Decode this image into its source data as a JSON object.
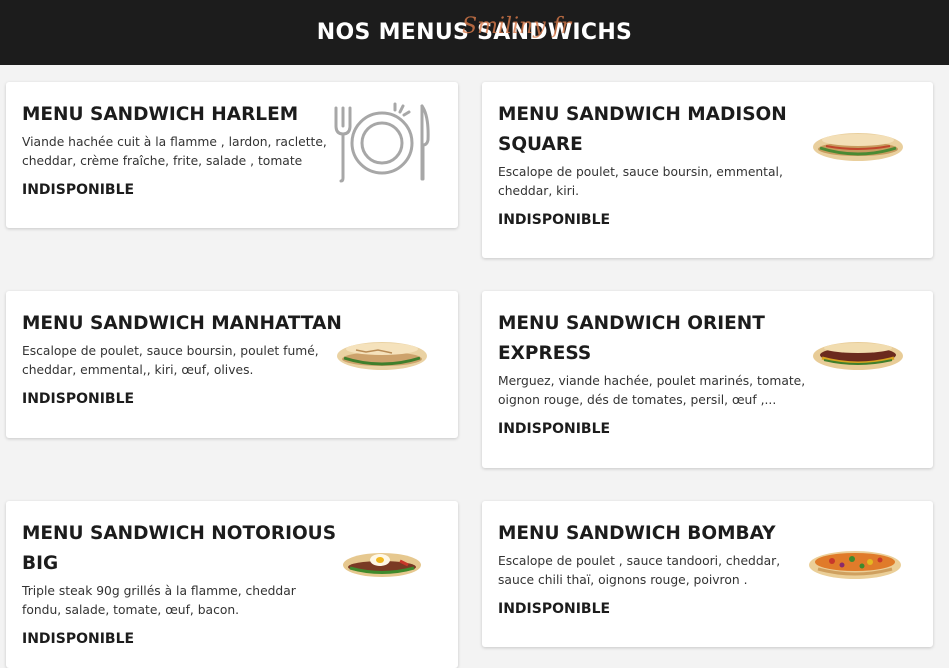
{
  "header": {
    "title": "NOS MENUS SANDWICHS",
    "watermark": "Smiliny fr"
  },
  "colors": {
    "header_bg": "#1c1c1c",
    "card_bg": "#ffffff",
    "page_bg": "#f3f3f3",
    "watermark": "#d97a4a"
  },
  "menus": [
    {
      "title": "MENU SANDWICH HARLEM",
      "desc_lines": [
        "Viande hachée cuit à la flamme , lardon, raclette,",
        "cheddar, crème fraîche, frite, salade , tomate"
      ],
      "status": "INDISPONIBLE",
      "icon": "plate-cutlery-icon"
    },
    {
      "title_lines": [
        "MENU SANDWICH MADISON",
        "SQUARE"
      ],
      "desc_lines": [
        "Escalope de poulet, sauce boursin, emmental,",
        "cheddar, kiri."
      ],
      "status": "INDISPONIBLE",
      "icon": "sandwich-icon"
    },
    {
      "title": "MENU SANDWICH MANHATTAN",
      "desc_lines": [
        "Escalope de poulet, sauce boursin, poulet fumé,",
        "cheddar, emmental,, kiri, œuf, olives."
      ],
      "status": "INDISPONIBLE",
      "icon": "sandwich-icon"
    },
    {
      "title_lines": [
        "MENU SANDWICH ORIENT",
        "EXPRESS"
      ],
      "desc_lines": [
        "Merguez, viande hachée, poulet marinés, tomate,",
        "oignon rouge, dés de tomates, persil, œuf ,..."
      ],
      "status": "INDISPONIBLE",
      "icon": "sandwich-icon"
    },
    {
      "title_lines": [
        "MENU SANDWICH NOTORIOUS",
        "BIG"
      ],
      "desc_lines": [
        "Triple steak 90g grillés à la flamme, cheddar",
        "fondu, salade, tomate, œuf, bacon."
      ],
      "status": "INDISPONIBLE",
      "icon": "sandwich-icon"
    },
    {
      "title": "MENU SANDWICH BOMBAY",
      "desc_lines": [
        "Escalope de poulet , sauce tandoori, cheddar,",
        "sauce chili thaï, oignons rouge, poivron ."
      ],
      "status": "INDISPONIBLE",
      "icon": "sandwich-icon"
    }
  ]
}
